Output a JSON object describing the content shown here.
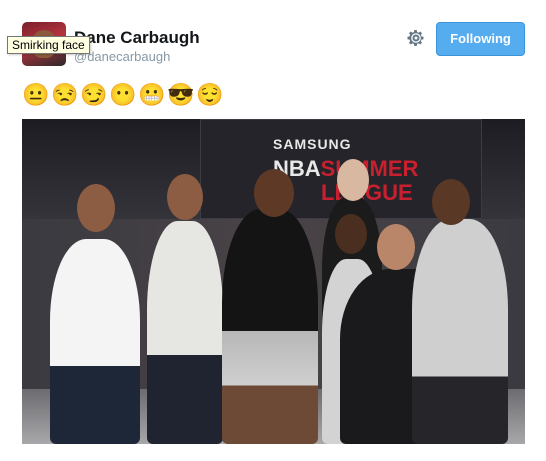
{
  "user": {
    "name": "Dane Carbaugh",
    "handle": "@danecarbaugh"
  },
  "tooltip": "Smirking face",
  "follow_button": "Following",
  "emojis": [
    "😐",
    "😒",
    "😏",
    "😶",
    "😬",
    "😎",
    "😌"
  ],
  "photo": {
    "banner_line1": "SAMSUNG",
    "banner_line2a": "NBA",
    "banner_line2b": "SUMMER",
    "banner_line3": "LEAGUE"
  },
  "colors": {
    "follow_bg": "#55acee",
    "name": "#14171a",
    "handle": "#8899a6"
  }
}
